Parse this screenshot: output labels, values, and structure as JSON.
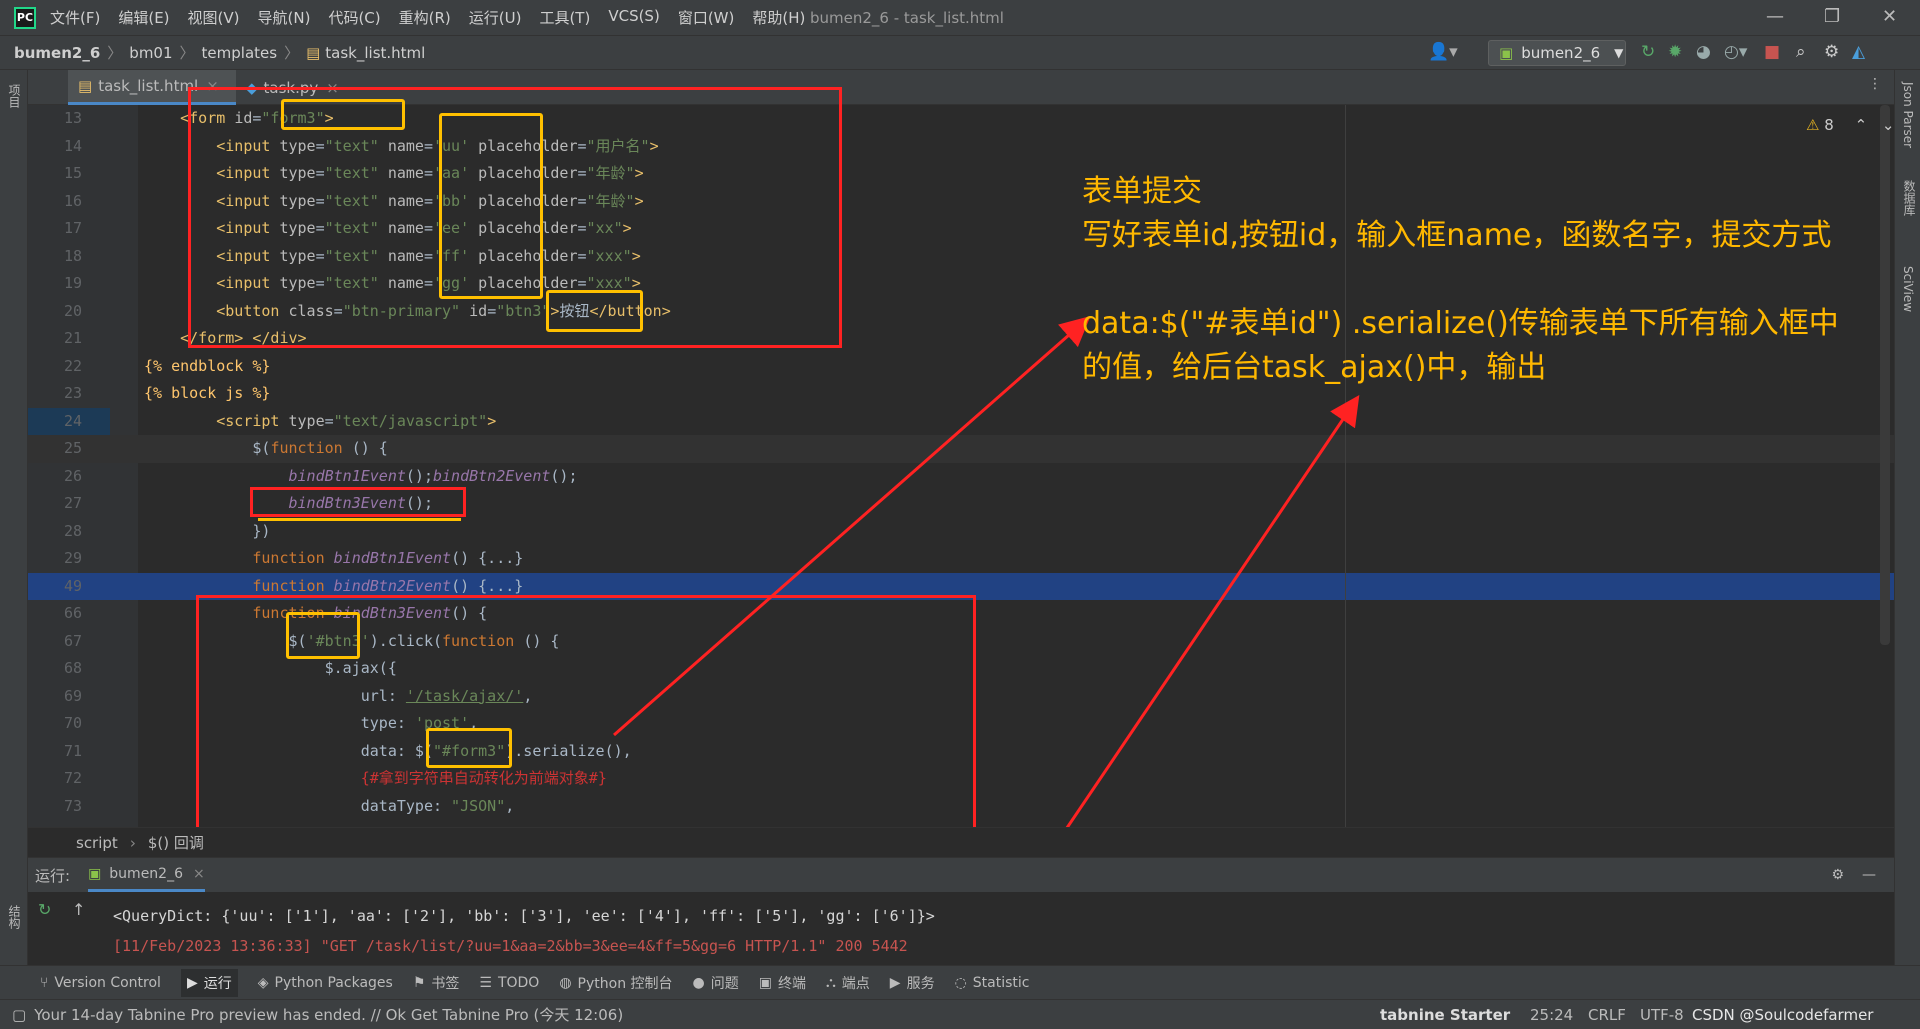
{
  "app": {
    "logo_text": "PC",
    "menu": [
      "文件(F)",
      "编辑(E)",
      "视图(V)",
      "导航(N)",
      "代码(C)",
      "重构(R)",
      "运行(U)",
      "工具(T)",
      "VCS(S)",
      "窗口(W)",
      "帮助(H)"
    ],
    "window_title": "bumen2_6 - task_list.html",
    "window_controls": [
      "—",
      "❐",
      "✕"
    ]
  },
  "nav": {
    "breadcrumbs": [
      "bumen2_6",
      "bm01",
      "templates",
      "task_list.html"
    ],
    "run_config": "bumen2_6"
  },
  "sidebars": {
    "left_top": "项目",
    "left_bottom": "结构",
    "right": [
      "Json Parser",
      "数据库",
      "SciView"
    ]
  },
  "tabs": [
    {
      "label": "task_list.html",
      "close": "×"
    },
    {
      "label": "task.py",
      "close": "×"
    }
  ],
  "editor": {
    "warning_count": "8",
    "lines": [
      {
        "n": "13",
        "parts": [
          [
            "t",
            "    <form "
          ],
          [
            "a",
            "id"
          ],
          [
            "b",
            "="
          ],
          [
            "s",
            "\"form3\""
          ],
          [
            "t",
            ">"
          ]
        ]
      },
      {
        "n": "14",
        "parts": [
          [
            "t",
            "        <input "
          ],
          [
            "a",
            "type"
          ],
          [
            "b",
            "="
          ],
          [
            "s",
            "\"text\" "
          ],
          [
            "a",
            "name"
          ],
          [
            "b",
            "="
          ],
          [
            "s",
            "'uu' "
          ],
          [
            "a",
            "placeholder"
          ],
          [
            "b",
            "="
          ],
          [
            "s",
            "\"用户名\""
          ],
          [
            "t",
            ">"
          ]
        ]
      },
      {
        "n": "15",
        "parts": [
          [
            "t",
            "        <input "
          ],
          [
            "a",
            "type"
          ],
          [
            "b",
            "="
          ],
          [
            "s",
            "\"text\" "
          ],
          [
            "a",
            "name"
          ],
          [
            "b",
            "="
          ],
          [
            "s",
            "'aa' "
          ],
          [
            "a",
            "placeholder"
          ],
          [
            "b",
            "="
          ],
          [
            "s",
            "\"年龄\""
          ],
          [
            "t",
            ">"
          ]
        ]
      },
      {
        "n": "16",
        "parts": [
          [
            "t",
            "        <input "
          ],
          [
            "a",
            "type"
          ],
          [
            "b",
            "="
          ],
          [
            "s",
            "\"text\" "
          ],
          [
            "a",
            "name"
          ],
          [
            "b",
            "="
          ],
          [
            "s",
            "'bb' "
          ],
          [
            "a",
            "placeholder"
          ],
          [
            "b",
            "="
          ],
          [
            "s",
            "\"年龄\""
          ],
          [
            "t",
            ">"
          ]
        ]
      },
      {
        "n": "17",
        "parts": [
          [
            "t",
            "        <input "
          ],
          [
            "a",
            "type"
          ],
          [
            "b",
            "="
          ],
          [
            "s",
            "\"text\" "
          ],
          [
            "a",
            "name"
          ],
          [
            "b",
            "="
          ],
          [
            "s",
            "'ee' "
          ],
          [
            "a",
            "placeholder"
          ],
          [
            "b",
            "="
          ],
          [
            "s",
            "\"xx\""
          ],
          [
            "t",
            ">"
          ]
        ]
      },
      {
        "n": "18",
        "parts": [
          [
            "t",
            "        <input "
          ],
          [
            "a",
            "type"
          ],
          [
            "b",
            "="
          ],
          [
            "s",
            "\"text\" "
          ],
          [
            "a",
            "name"
          ],
          [
            "b",
            "="
          ],
          [
            "s",
            "'ff' "
          ],
          [
            "a",
            "placeholder"
          ],
          [
            "b",
            "="
          ],
          [
            "s",
            "\"xxx\""
          ],
          [
            "t",
            ">"
          ]
        ]
      },
      {
        "n": "19",
        "parts": [
          [
            "t",
            "        <input "
          ],
          [
            "a",
            "type"
          ],
          [
            "b",
            "="
          ],
          [
            "s",
            "\"text\" "
          ],
          [
            "a",
            "name"
          ],
          [
            "b",
            "="
          ],
          [
            "s",
            "'gg' "
          ],
          [
            "a",
            "placeholder"
          ],
          [
            "b",
            "="
          ],
          [
            "s",
            "\"xxx\""
          ],
          [
            "t",
            ">"
          ]
        ]
      },
      {
        "n": "20",
        "parts": [
          [
            "t",
            "        <button "
          ],
          [
            "a",
            "class"
          ],
          [
            "b",
            "="
          ],
          [
            "s",
            "\"btn-primary\" "
          ],
          [
            "a",
            "id"
          ],
          [
            "b",
            "="
          ],
          [
            "s",
            "\"btn3\""
          ],
          [
            "t",
            ">"
          ],
          [
            "b",
            "按钮"
          ],
          [
            "t",
            "</button>"
          ]
        ]
      },
      {
        "n": "21",
        "parts": [
          [
            "t",
            "    </form> </div>"
          ]
        ]
      },
      {
        "n": "22",
        "parts": [
          [
            "f",
            "{% endblock %}"
          ]
        ]
      },
      {
        "n": "23",
        "parts": [
          [
            "f",
            "{% block js %}"
          ]
        ]
      },
      {
        "n": "24",
        "parts": [
          [
            "t",
            "        <script "
          ],
          [
            "a",
            "type"
          ],
          [
            "b",
            "="
          ],
          [
            "s",
            "\"text/javascript\""
          ],
          [
            "t",
            ">"
          ]
        ]
      },
      {
        "n": "25",
        "parts": [
          [
            "b",
            "            $("
          ],
          [
            "k",
            "function "
          ],
          [
            "b",
            "() {"
          ]
        ]
      },
      {
        "n": "26",
        "parts": [
          [
            "i",
            "                bindBtn1Event"
          ],
          [
            "b",
            "();"
          ],
          [
            "i",
            "bindBtn2Event"
          ],
          [
            "b",
            "();"
          ]
        ]
      },
      {
        "n": "27",
        "parts": [
          [
            "i",
            "                bindBtn3Event"
          ],
          [
            "b",
            "();"
          ]
        ]
      },
      {
        "n": "28",
        "parts": [
          [
            "b",
            "            })"
          ]
        ]
      },
      {
        "n": "29",
        "parts": [
          [
            "k",
            "            function "
          ],
          [
            "i",
            "bindBtn1Event"
          ],
          [
            "b",
            "() {...}"
          ]
        ]
      },
      {
        "n": "49",
        "parts": [
          [
            "k",
            "            function "
          ],
          [
            "i",
            "bindBtn2Event"
          ],
          [
            "b",
            "() {...}"
          ]
        ]
      },
      {
        "n": "66",
        "parts": [
          [
            "k",
            "            function "
          ],
          [
            "i",
            "bindBtn3Event"
          ],
          [
            "b",
            "() {"
          ]
        ]
      },
      {
        "n": "67",
        "parts": [
          [
            "b",
            "                $("
          ],
          [
            "s",
            "'#btn3'"
          ],
          [
            "b",
            ").click("
          ],
          [
            "k",
            "function "
          ],
          [
            "b",
            "() {"
          ]
        ]
      },
      {
        "n": "68",
        "parts": [
          [
            "b",
            "                    $.ajax({"
          ]
        ]
      },
      {
        "n": "69",
        "parts": [
          [
            "b",
            "                        url: "
          ],
          [
            "u",
            "'/task/ajax/'"
          ],
          [
            "b",
            ","
          ]
        ]
      },
      {
        "n": "70",
        "parts": [
          [
            "b",
            "                        type: "
          ],
          [
            "s",
            "'post'"
          ],
          [
            "b",
            ","
          ]
        ]
      },
      {
        "n": "71",
        "parts": [
          [
            "b",
            "                        data: $("
          ],
          [
            "s",
            "\"#form3\""
          ],
          [
            "b",
            ").serialize(),"
          ]
        ]
      },
      {
        "n": "72",
        "parts": [
          [
            "cm",
            "                        {#拿到字符串自动转化为前端对象#}"
          ]
        ]
      },
      {
        "n": "73",
        "parts": [
          [
            "b",
            "                        dataType: "
          ],
          [
            "s",
            "\"JSON\""
          ],
          [
            "b",
            ","
          ]
        ]
      }
    ]
  },
  "annotation": {
    "line1": "表单提交",
    "line2": "写好表单id,按钮id，输入框name，函数名字，提交方式",
    "line3": "data:$(\"#表单id\") .serialize()传输表单下所有输入框中",
    "line4": "的值，给后台task_ajax()中，输出"
  },
  "code_breadcrumb": [
    "script",
    "$() 回调"
  ],
  "run_panel": {
    "label": "运行:",
    "tab": "bumen2_6",
    "output": [
      "<QueryDict: {'uu': ['1'], 'aa': ['2'], 'bb': ['3'], 'ee': ['4'], 'ff': ['5'], 'gg': ['6']}>",
      "[11/Feb/2023 13:36:33] \"GET /task/list/?uu=1&aa=2&bb=3&ee=4&ff=5&gg=6 HTTP/1.1\" 200 5442"
    ]
  },
  "tool_windows": [
    "Version Control",
    "运行",
    "Python Packages",
    "书签",
    "TODO",
    "Python 控制台",
    "问题",
    "终端",
    "端点",
    "服务",
    "Statistic"
  ],
  "status": {
    "message": "Your 14-day Tabnine Pro preview has ended. // Ok   Get Tabnine Pro (今天 12:06)",
    "tabnine": "tabnine Starter",
    "position": "25:24",
    "line_sep": "CRLF",
    "encoding": "UTF-8",
    "watermark": "CSDN @Soulcodefarmer"
  },
  "colors": {
    "red_box": "#ff2222",
    "yellow_box": "#ffc000",
    "annotation": "#ffb800"
  }
}
